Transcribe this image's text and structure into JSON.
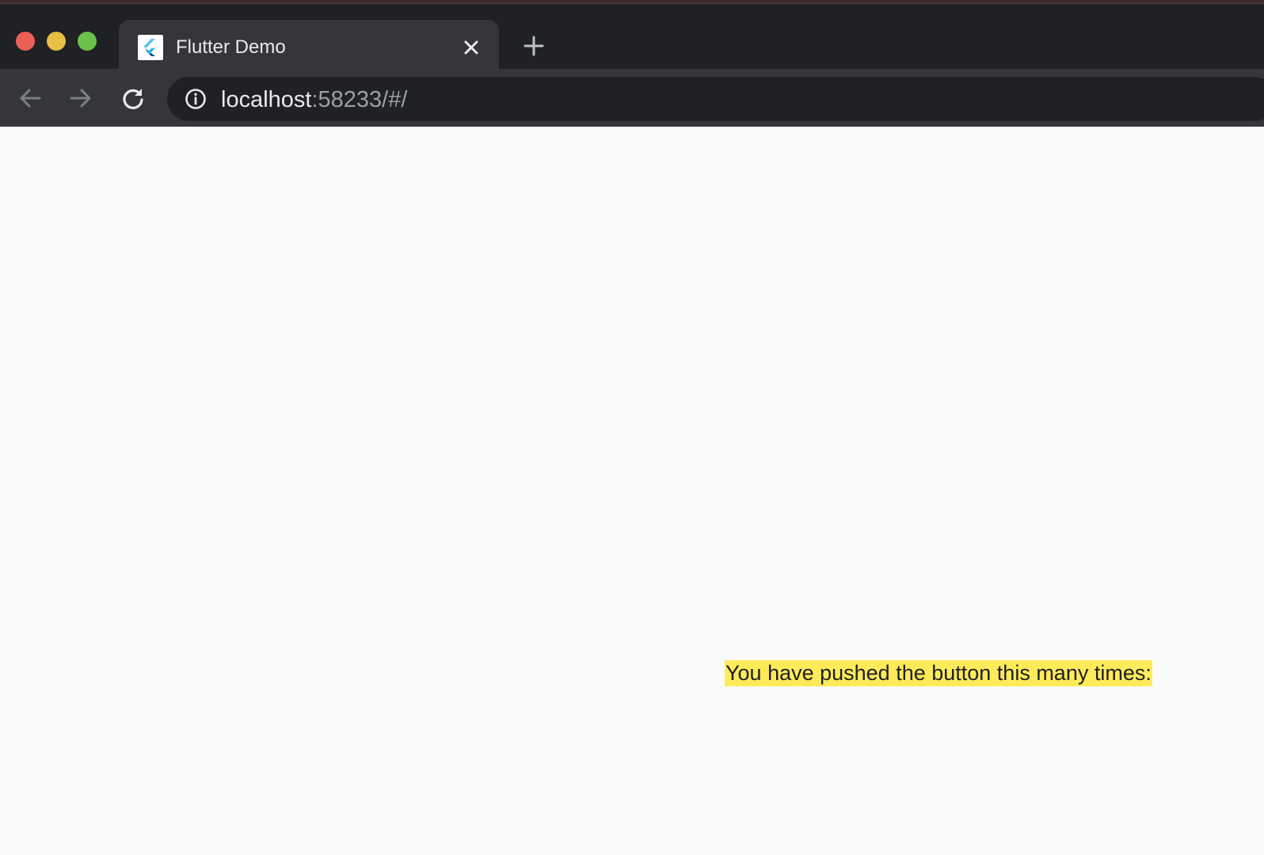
{
  "window": {
    "controls": {
      "close_color": "#ec5f56",
      "minimize_color": "#e6bf44",
      "maximize_color": "#6bc24b"
    }
  },
  "tabs": [
    {
      "title": "Flutter Demo",
      "favicon": "flutter-logo-icon",
      "active": true,
      "close_icon": "close-icon"
    }
  ],
  "toolbar": {
    "new_tab_icon": "plus-icon",
    "back_icon": "arrow-left-icon",
    "forward_icon": "arrow-right-icon",
    "reload_icon": "reload-icon",
    "site_info_icon": "info-circle-icon"
  },
  "address_bar": {
    "host": "localhost",
    "rest": ":58233/#/"
  },
  "page": {
    "counter_message": "You have pushed the button this many times:",
    "highlight_color": "#ffeb5a"
  }
}
